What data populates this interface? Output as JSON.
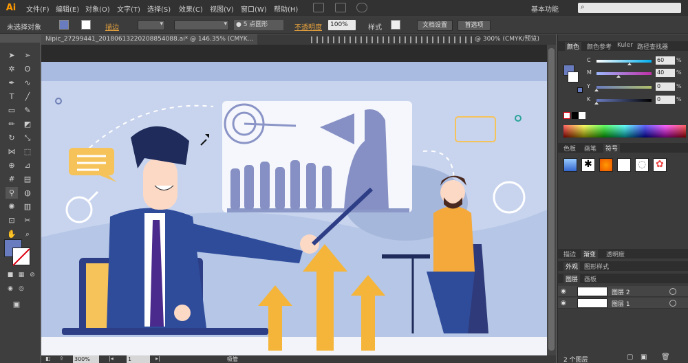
{
  "app": {
    "logo": "Ai"
  },
  "menu": [
    "文件(F)",
    "编辑(E)",
    "对象(O)",
    "文字(T)",
    "选择(S)",
    "效果(C)",
    "视图(V)",
    "窗口(W)",
    "帮助(H)"
  ],
  "workspace": "基本功能",
  "control": {
    "selection": "未选择对象",
    "stroke_label": "描边",
    "brush_value": "5 点圆形",
    "opacity_label": "不透明度",
    "opacity_value": "100%",
    "style_label": "样式",
    "doc_setup": "文档设置",
    "prefs": "首选项"
  },
  "tabs": {
    "doc": "Nipic_27299441_20180613220208854088.ai* @ 146.35% (CMYK...",
    "doc2": "@ 300% (CMYK/预览)"
  },
  "status": {
    "zoom": "300%",
    "page": "1",
    "tool": "吸管"
  },
  "color_panel": {
    "tabs": [
      "颜色",
      "颜色参考",
      "Kuler",
      "路径查找器"
    ],
    "channels": [
      {
        "name": "C",
        "value": "60",
        "level": 0.6
      },
      {
        "name": "M",
        "value": "40",
        "level": 0.4
      },
      {
        "name": "Y",
        "value": "0",
        "level": 0
      },
      {
        "name": "K",
        "value": "0",
        "level": 0
      }
    ],
    "fill": "#6a7cc0"
  },
  "symbol_panel": {
    "tabs": [
      "色板",
      "画笔",
      "符号"
    ]
  },
  "stroke_panel": {
    "tabs": [
      "描边",
      "渐变",
      "透明度"
    ]
  },
  "appearance_panel": {
    "tabs": [
      "外观",
      "图形样式"
    ]
  },
  "layers_panel": {
    "tabs": [
      "图层",
      "画板"
    ],
    "layers": [
      "图层 2",
      "图层 1"
    ],
    "footer": "2 个图层"
  },
  "colors": {
    "accent": "#ff9a00",
    "artboard_bg": "#c5d2ec",
    "suit": "#2f4c9b",
    "arrow": "#f5b53a"
  }
}
